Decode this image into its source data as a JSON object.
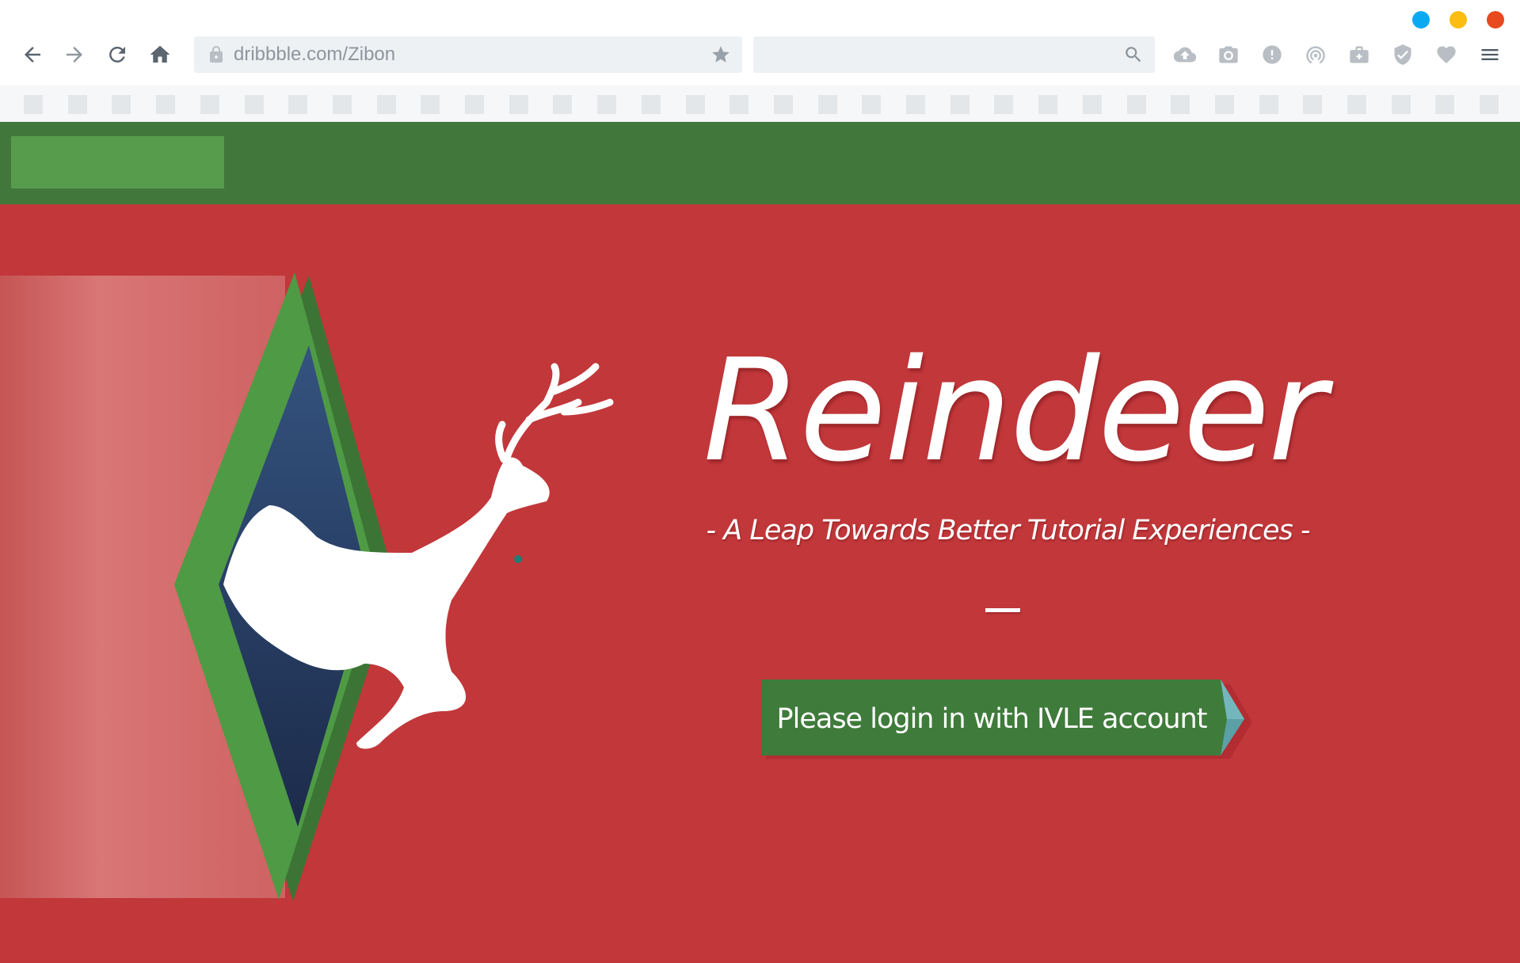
{
  "window_controls": {
    "colors": [
      "#0aaaf2",
      "#fdbd10",
      "#e8491e"
    ],
    "names": [
      "window-dot-blue",
      "window-dot-yellow",
      "window-dot-red"
    ]
  },
  "toolbar": {
    "back_icon": "arrow-left-icon",
    "forward_icon": "arrow-right-icon",
    "reload_icon": "reload-icon",
    "home_icon": "home-icon",
    "url": "dribbble.com/Zibon",
    "search_placeholder": "",
    "extension_icons": [
      "cloud-upload-icon",
      "camera-icon",
      "alert-icon",
      "broadcast-icon",
      "briefcase-icon",
      "shield-check-icon",
      "heart-icon",
      "hamburger-menu-icon"
    ]
  },
  "bookmarks_bar": {
    "slot_count": 34
  },
  "page": {
    "header_color": "#41773b",
    "logo_color": "#579c4d",
    "hero_color": "#c1373a",
    "title": "Reindeer",
    "tagline": "- A Leap Towards Better Tutorial Experiences -",
    "login_button_label": "Please login in with IVLE account",
    "button_color": "#3f7b3a"
  }
}
